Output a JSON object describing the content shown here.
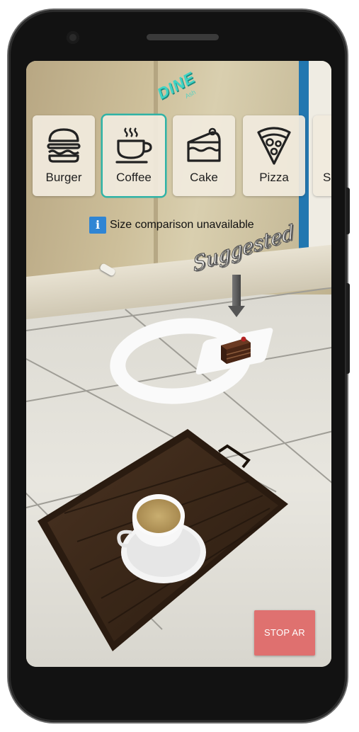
{
  "app": {
    "logo_text": "DINE",
    "logo_sub": "Ash"
  },
  "menu": {
    "items": [
      {
        "label": "Burger",
        "icon": "burger-icon",
        "selected": false
      },
      {
        "label": "Coffee",
        "icon": "coffee-icon",
        "selected": true
      },
      {
        "label": "Cake",
        "icon": "cake-icon",
        "selected": false
      },
      {
        "label": "Pizza",
        "icon": "pizza-icon",
        "selected": false
      },
      {
        "label": "S",
        "icon": "partial-icon",
        "selected": false
      }
    ]
  },
  "info": {
    "icon": "info-icon",
    "glyph": "i",
    "message": "Size comparison unavailable"
  },
  "placement": {
    "suggested_label": "Suggested"
  },
  "controls": {
    "stop_label": "STOP AR"
  },
  "colors": {
    "accent": "#2fb3a6",
    "info_blue": "#2f85d4",
    "stop_red": "#df5e5e",
    "logo_teal": "#3fd3c4"
  }
}
